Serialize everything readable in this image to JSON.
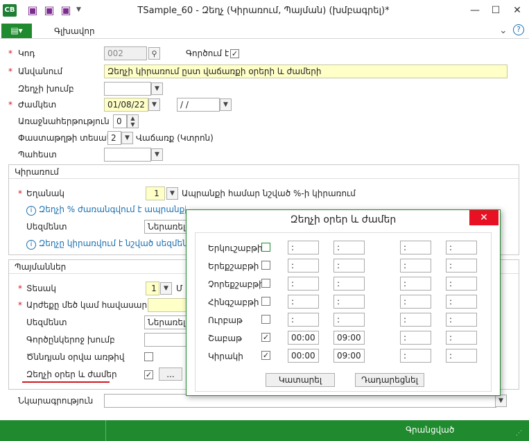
{
  "window": {
    "title": "TSample_60 - Զեղչ (Կիրառում, Պայման) (խմբագրել)*",
    "app_logo": "CB",
    "quick_icons": [
      "save-icon",
      "save-close-icon",
      "save-copy-icon"
    ],
    "minimize": "—",
    "maximize": "☐",
    "close": "✕"
  },
  "ribbon": {
    "file_tab": "▤▾",
    "main_tab": "Գլխավոր",
    "collapse": "⌄",
    "help": "?"
  },
  "form": {
    "code_label": "Կոդ",
    "code_value": "002",
    "active_label": "Գործում է",
    "active_checked": true,
    "name_label": "Անվանում",
    "name_value": "Զեղչի կիրառում ըստ վաճառքի օրերի և ժամերի",
    "group_label": "Զեղչի խումբ",
    "group_value": "",
    "period_label": "Ժամկետ",
    "period_from": "01/08/22",
    "period_to": " /  /",
    "priority_label": "Առաջնահերթություն",
    "priority_value": "0",
    "doc_type_label": "Փաստաթղթի տեսակ",
    "doc_type_value": "2",
    "doc_type_desc": "Վաճառք (Կտրոն)",
    "warehouse_label": "Պահեստ",
    "warehouse_value": ""
  },
  "apply": {
    "title": "Կիրառում",
    "method_label": "Եղանակ",
    "method_value": "1",
    "method_desc": "Ապրանքի համար նշված %-ի կիրառում",
    "info1": "Զեղչի % ժառանգվում է ապրանքի տեղեկատուից",
    "rounding_label": "Սեզմենտ",
    "rounding_value": "Ներառել",
    "info2": "Զեղչը կիրառվում է նշված սեզմենտի"
  },
  "conditions": {
    "title": "Պայմաններ",
    "type_label": "Տեսակ",
    "type_value": "1",
    "type_desc": "Մ",
    "value_label": "Արժեքը մեծ կամ հավասար է",
    "segment_label": "Սեզմենտ",
    "segment_value": "Ներառել",
    "partners_label": "Գործընկերոջ խումբ",
    "birthday_label": "Ծննդյան օրվա առթիվ",
    "days_label": "Զեղչի օրեր և ժամեր",
    "days_checked": true,
    "days_button": "..."
  },
  "description_label": "Նկարագրություն",
  "status": {
    "text": "Գրանցված"
  },
  "dialog": {
    "title": "Զեղչի օրեր և ժամեր",
    "close": "✕",
    "rows": [
      {
        "day": "Երկուշաբթի",
        "checked": false,
        "t1": " : ",
        "t2": " : ",
        "t3": " : ",
        "t4": " : "
      },
      {
        "day": "Երեքշաբթի",
        "checked": false,
        "t1": " : ",
        "t2": " : ",
        "t3": " : ",
        "t4": " : "
      },
      {
        "day": "Չորեքշաբթի",
        "checked": false,
        "t1": " : ",
        "t2": " : ",
        "t3": " : ",
        "t4": " : "
      },
      {
        "day": "Հինգշաբթի",
        "checked": false,
        "t1": " : ",
        "t2": " : ",
        "t3": " : ",
        "t4": " : "
      },
      {
        "day": "Ուրբաթ",
        "checked": false,
        "t1": " : ",
        "t2": " : ",
        "t3": " : ",
        "t4": " : "
      },
      {
        "day": "Շաբաթ",
        "checked": true,
        "t1": "00:00",
        "t2": "09:00",
        "t3": " : ",
        "t4": " : "
      },
      {
        "day": "Կիրակի",
        "checked": true,
        "t1": "00:00",
        "t2": "09:00",
        "t3": " : ",
        "t4": " : "
      }
    ],
    "ok_label": "Կատարել",
    "cancel_label": "Դադարեցնել"
  },
  "colors": {
    "accent": "#1f8a2e",
    "required": "#d0161e",
    "info": "#1a6fb0",
    "highlight": "#ffffc8",
    "close": "#e81123"
  }
}
